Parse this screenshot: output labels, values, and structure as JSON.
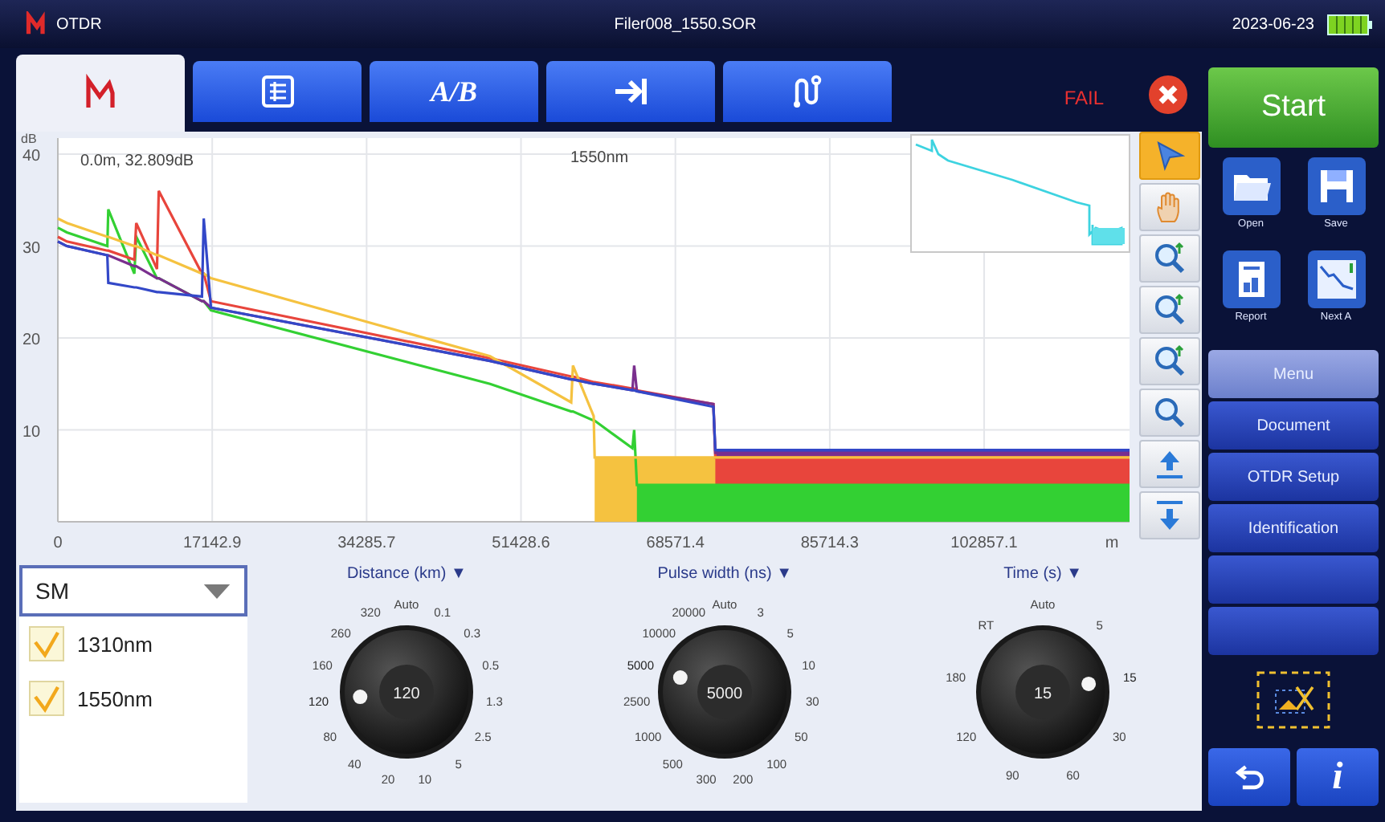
{
  "header": {
    "app": "OTDR",
    "file": "Filer008_1550.SOR",
    "date": "2023-06-23"
  },
  "tabs": [
    {
      "kind": "trace",
      "selected": true
    },
    {
      "kind": "table",
      "selected": false
    },
    {
      "kind": "text",
      "label": "A/B",
      "selected": false
    },
    {
      "kind": "arrow",
      "selected": false
    },
    {
      "kind": "link",
      "selected": false
    }
  ],
  "result": {
    "label": "FAIL"
  },
  "chart": {
    "readout": "0.0m, 32.809dB",
    "wavelength": "1550nm",
    "chart_data": {
      "type": "line",
      "xlabel": "m",
      "ylabel": "dB",
      "xlim": [
        0,
        119000
      ],
      "ylim": [
        0,
        40
      ],
      "xticks": [
        {
          "value": 0,
          "label": "0"
        },
        {
          "value": 17142.9,
          "label": "17142.9"
        },
        {
          "value": 34285.7,
          "label": "34285.7"
        },
        {
          "value": 51428.6,
          "label": "51428.6"
        },
        {
          "value": 68571.4,
          "label": "68571.4"
        },
        {
          "value": 85714.3,
          "label": "85714.3"
        },
        {
          "value": 102857.1,
          "label": "102857.1"
        }
      ],
      "yticks": [
        10,
        20,
        30,
        40
      ],
      "grid": true,
      "x": [
        0,
        1000,
        5500,
        5600,
        8500,
        8700,
        11000,
        11200,
        16000,
        16200,
        17000,
        48000,
        57000,
        57200,
        59500,
        59600,
        63800,
        64000,
        64300,
        72800,
        73000,
        119000
      ],
      "series": [
        {
          "color": "#3348c8",
          "values": [
            30.5,
            30,
            29,
            26,
            25.5,
            25.5,
            25,
            25,
            24.5,
            33,
            23.3,
            17.5,
            15.5,
            15.5,
            15,
            15,
            14.3,
            14.3,
            14.2,
            12.5,
            7.8,
            7.8
          ]
        },
        {
          "color": "#7a2f8e",
          "values": [
            30.5,
            30,
            29,
            29,
            27.8,
            27.8,
            26.5,
            26.5,
            24,
            24,
            23.3,
            17.5,
            15.5,
            15.5,
            15,
            15,
            14.3,
            17,
            14.2,
            12.8,
            7.5,
            7.5
          ]
        },
        {
          "color": "#f5c240",
          "values": [
            33,
            32.5,
            31,
            31,
            30,
            30,
            29,
            29,
            27,
            27,
            26.5,
            18,
            13,
            17,
            11.5,
            7,
            7,
            7,
            7,
            7,
            7,
            7
          ]
        },
        {
          "color": "#e8453c",
          "values": [
            31,
            30.5,
            29.5,
            29.5,
            28.5,
            32.5,
            27.5,
            36,
            27,
            27,
            24,
            17.8,
            15.8,
            15.8,
            15.2,
            15.2,
            14.5,
            14.5,
            14.3,
            12.8,
            7,
            7
          ]
        },
        {
          "color": "#33d033",
          "values": [
            32,
            31.5,
            30,
            34,
            27,
            31,
            26.5,
            26.5,
            24,
            24,
            23,
            15,
            12,
            12,
            11,
            11,
            8,
            10,
            4,
            4,
            4,
            4
          ]
        }
      ]
    }
  },
  "tools": [
    {
      "kind": "pointer",
      "selected": true
    },
    {
      "kind": "hand",
      "selected": false
    },
    {
      "kind": "zoomx",
      "selected": false
    },
    {
      "kind": "zoomy",
      "selected": false
    },
    {
      "kind": "zoomin",
      "selected": false
    },
    {
      "kind": "zoomout",
      "selected": false
    },
    {
      "kind": "up",
      "selected": false
    },
    {
      "kind": "down",
      "selected": false
    }
  ],
  "fiber": {
    "mode": "SM",
    "wavelengths": [
      {
        "label": "1310nm",
        "checked": true
      },
      {
        "label": "1550nm",
        "checked": true
      }
    ]
  },
  "dials": [
    {
      "title": "Distance (km) ▼",
      "value": "120",
      "scale": [
        {
          "label": "Auto",
          "selected": false
        },
        {
          "label": "0.1",
          "selected": false
        },
        {
          "label": "0.3",
          "selected": false
        },
        {
          "label": "0.5",
          "selected": false
        },
        {
          "label": "1.3",
          "selected": false
        },
        {
          "label": "2.5",
          "selected": false
        },
        {
          "label": "5",
          "selected": false
        },
        {
          "label": "10",
          "selected": false
        },
        {
          "label": "20",
          "selected": false
        },
        {
          "label": "40",
          "selected": false
        },
        {
          "label": "80",
          "selected": false
        },
        {
          "label": "120",
          "selected": true
        },
        {
          "label": "160",
          "selected": false
        },
        {
          "label": "260",
          "selected": false
        },
        {
          "label": "320",
          "selected": false
        }
      ]
    },
    {
      "title": "Pulse width (ns) ▼",
      "value": "5000",
      "scale": [
        {
          "label": "Auto",
          "selected": false
        },
        {
          "label": "3",
          "selected": false
        },
        {
          "label": "5",
          "selected": false
        },
        {
          "label": "10",
          "selected": false
        },
        {
          "label": "30",
          "selected": false
        },
        {
          "label": "50",
          "selected": false
        },
        {
          "label": "100",
          "selected": false
        },
        {
          "label": "200",
          "selected": false
        },
        {
          "label": "300",
          "selected": false
        },
        {
          "label": "500",
          "selected": false
        },
        {
          "label": "1000",
          "selected": false
        },
        {
          "label": "2500",
          "selected": false
        },
        {
          "label": "5000",
          "selected": true
        },
        {
          "label": "10000",
          "selected": false
        },
        {
          "label": "20000",
          "selected": false
        }
      ]
    },
    {
      "title": "Time (s) ▼",
      "value": "15",
      "scale": [
        {
          "label": "Auto",
          "selected": false
        },
        {
          "label": "5",
          "selected": false
        },
        {
          "label": "15",
          "selected": true
        },
        {
          "label": "30",
          "selected": false
        },
        {
          "label": "60",
          "selected": false
        },
        {
          "label": "90",
          "selected": false
        },
        {
          "label": "120",
          "selected": false
        },
        {
          "label": "180",
          "selected": false
        },
        {
          "label": "RT",
          "selected": false
        }
      ]
    }
  ],
  "side": {
    "start": "Start",
    "files": [
      {
        "kind": "open",
        "label": "Open"
      },
      {
        "kind": "save",
        "label": "Save"
      },
      {
        "kind": "report",
        "label": "Report"
      },
      {
        "kind": "next",
        "label": "Next A"
      }
    ],
    "menu": {
      "title": "Menu",
      "items": [
        {
          "kind": "item",
          "label": "Document"
        },
        {
          "kind": "item",
          "label": "OTDR Setup"
        },
        {
          "kind": "item",
          "label": "Identification"
        },
        {
          "kind": "blank"
        },
        {
          "kind": "blank"
        }
      ]
    },
    "info": "i"
  }
}
